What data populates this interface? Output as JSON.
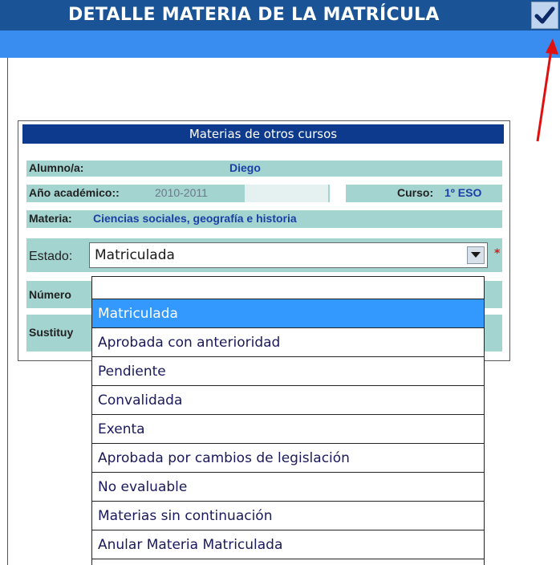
{
  "header": {
    "title": "DETALLE MATERIA DE LA MATRÍCULA",
    "confirm_icon": "checkmark-icon",
    "title_bar_color": "#1a5496",
    "sub_bar_color": "#3a8df0"
  },
  "panel": {
    "title": "Materias de otros cursos",
    "alumno": {
      "label": "Alumno/a:",
      "value": "Diego"
    },
    "anio": {
      "label": "Año académico::",
      "value": "2010-2011"
    },
    "curso": {
      "label": "Curso:",
      "value": "1º ESO"
    },
    "materia": {
      "label": "Materia:",
      "value": "Ciencias sociales, geografía e historia"
    },
    "estado": {
      "label": "Estado:",
      "selected": "Matriculada",
      "required_mark": "*"
    },
    "numero": {
      "label": "Número"
    },
    "sustituye": {
      "label": "Sustituy"
    }
  },
  "dropdown": {
    "options": [
      "",
      "Matriculada",
      "Aprobada con anterioridad",
      "Pendiente",
      "Convalidada",
      "Exenta",
      "Aprobada por cambios de legislación",
      "No evaluable",
      "Materias sin continuación",
      "Anular Materia Matriculada"
    ],
    "highlighted": "Matriculada",
    "highlight_color": "#3399ff"
  },
  "colors": {
    "accent": "#0d3a8c",
    "row_background": "#a3d4d0",
    "value_text": "#1a3fa8",
    "annotation_arrow": "#e01010"
  }
}
